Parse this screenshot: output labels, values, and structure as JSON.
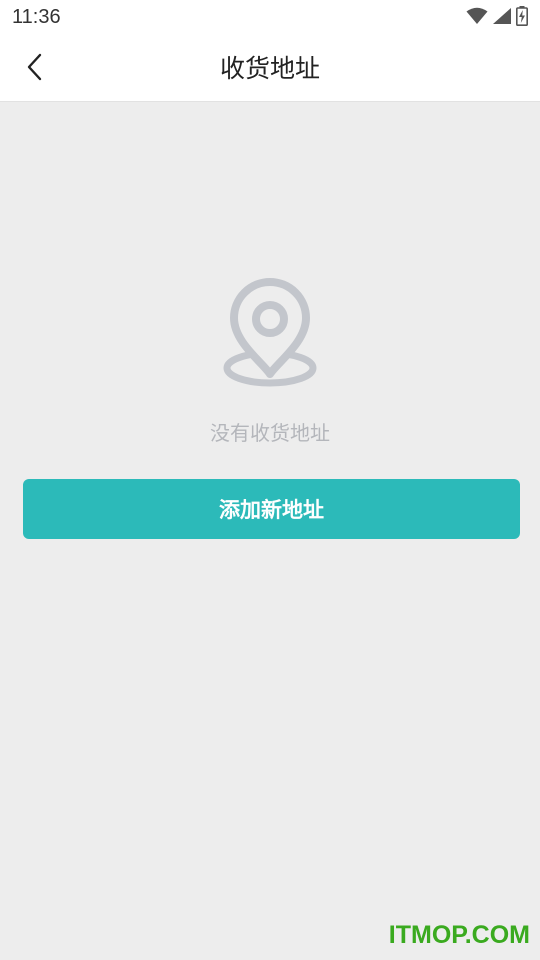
{
  "status_bar": {
    "time": "11:36",
    "icons": [
      "wifi-icon",
      "cellular-signal-icon",
      "battery-charging-icon"
    ]
  },
  "nav": {
    "back_icon": "chevron-left-icon",
    "title": "收货地址"
  },
  "empty_state": {
    "icon": "location-pin-icon",
    "message": "没有收货地址"
  },
  "actions": {
    "add_address_label": "添加新地址"
  },
  "watermark": {
    "text": "ITMOP.COM"
  },
  "colors": {
    "accent": "#2cbab9",
    "background": "#ededed",
    "empty_icon": "#c3c6cc",
    "watermark": "#3aaa1f"
  }
}
